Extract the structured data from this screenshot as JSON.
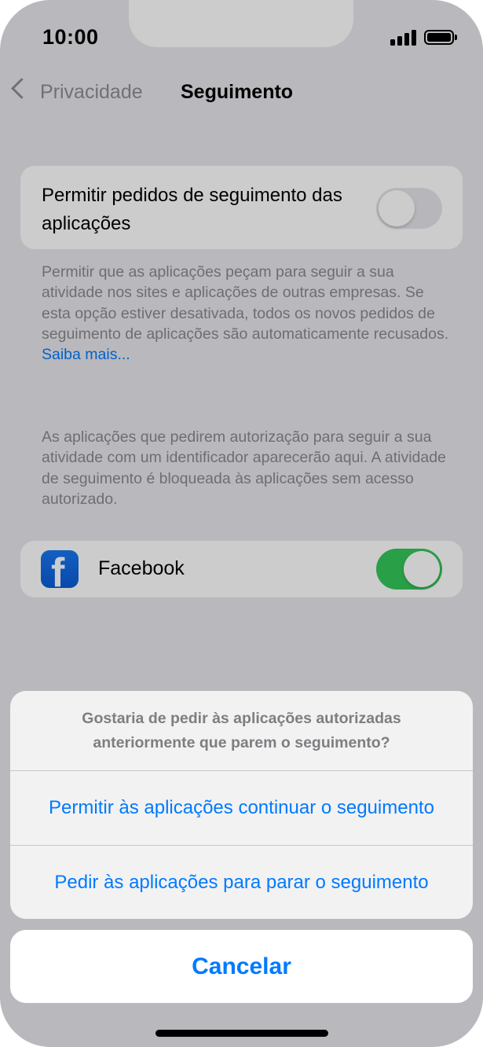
{
  "status_bar": {
    "time": "10:00"
  },
  "nav": {
    "back_label": "Privacidade",
    "title": "Seguimento"
  },
  "allow_requests": {
    "label": "Permitir pedidos de seguimento das aplicações",
    "enabled": false,
    "footnote": "Permitir que as aplicações peçam para seguir a sua atividade nos sites e aplicações de outras empresas. Se esta opção estiver desativada, todos os novos pedidos de seguimento de aplicações são automaticamente recusados.",
    "learn_more": "Saiba mais..."
  },
  "apps_section": {
    "footnote": "As aplicações que pedirem autorização para seguir a sua atividade com um identificador aparecerão aqui. A atividade de seguimento é bloqueada às aplicações sem acesso autorizado.",
    "apps": [
      {
        "name": "Facebook",
        "icon": "facebook-icon",
        "enabled": true
      }
    ]
  },
  "action_sheet": {
    "message": "Gostaria de pedir às aplicações autorizadas anteriormente que parem o seguimento?",
    "actions": [
      {
        "label": "Permitir às aplicações continuar o seguimento"
      },
      {
        "label": "Pedir às aplicações para parar o seguimento"
      }
    ],
    "cancel_label": "Cancelar"
  },
  "colors": {
    "accent": "#007aff",
    "toggle_on": "#34c759",
    "toggle_off": "#e5e5ea",
    "background": "#f2f2f7",
    "facebook_blue": "#1877f2"
  }
}
